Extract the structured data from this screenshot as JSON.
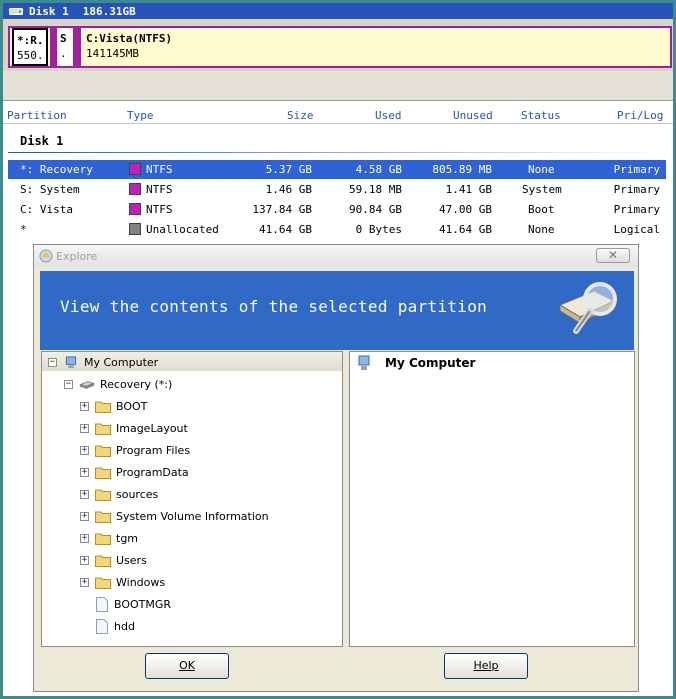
{
  "disk_header": {
    "label": "Disk 1",
    "capacity": "186.31GB"
  },
  "disk_map": {
    "seg1": {
      "name": "*:R.",
      "size": "550.."
    },
    "seg2": {
      "name": "S",
      "size": "."
    },
    "seg3": {
      "name": "C:Vista(NTFS)",
      "size": "141145MB"
    }
  },
  "table": {
    "columns": [
      "Partition",
      "Type",
      "Size",
      "Used",
      "Unused",
      "Status",
      "Pri/Log"
    ],
    "disk_label": "Disk 1",
    "rows": [
      {
        "partition": "*: Recovery",
        "type": "NTFS",
        "size": "5.37 GB",
        "used": "4.58 GB",
        "unused": "805.89 MB",
        "status": "None",
        "prilog": "Primary",
        "color": "#c020b8"
      },
      {
        "partition": "S: System",
        "type": "NTFS",
        "size": "1.46 GB",
        "used": "59.18 MB",
        "unused": "1.41 GB",
        "status": "System",
        "prilog": "Primary",
        "color": "#c020b8"
      },
      {
        "partition": "C: Vista",
        "type": "NTFS",
        "size": "137.84 GB",
        "used": "90.84 GB",
        "unused": "47.00 GB",
        "status": "Boot",
        "prilog": "Primary",
        "color": "#c020b8"
      },
      {
        "partition": "*",
        "type": "Unallocated",
        "size": "41.64 GB",
        "used": "0 Bytes",
        "unused": "41.64 GB",
        "status": "None",
        "prilog": "Logical",
        "color": "#808080"
      }
    ]
  },
  "dialog": {
    "title": "Explore",
    "close_label": "✕",
    "banner": "View the contents of the selected partition",
    "tree": {
      "root": "My Computer",
      "drive": "Recovery (*:)",
      "folders": [
        "BOOT",
        "ImageLayout",
        "Program Files",
        "ProgramData",
        "sources",
        "System Volume Information",
        "tgm",
        "Users",
        "Windows"
      ],
      "files": [
        "BOOTMGR",
        "hdd"
      ]
    },
    "detail_title": "My Computer",
    "ok_label": "OK",
    "help_label": "Help"
  },
  "colors": {
    "accent": "#3169c6",
    "selection": "#2f62d4",
    "ntfs": "#c020b8",
    "frame": "#3f8a8a"
  }
}
